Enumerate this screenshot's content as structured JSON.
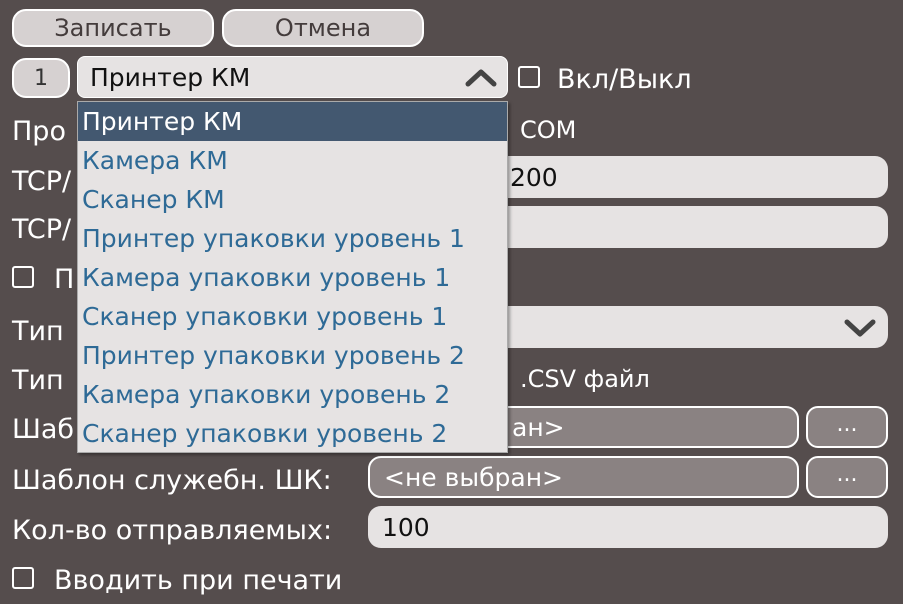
{
  "toolbar": {
    "save_label": "Записать",
    "cancel_label": "Отмена"
  },
  "device": {
    "index": "1",
    "selected_type": "Принтер КМ",
    "enabled_label": "Вкл/Выкл"
  },
  "dropdown": {
    "options": [
      "Принтер КМ",
      "Камера КМ",
      "Сканер КМ",
      "Принтер упаковки уровень 1",
      "Камера упаковки уровень 1",
      "Сканер упаковки уровень 1",
      "Принтер упаковки уровень 2",
      "Камера упаковки уровень 2",
      "Сканер упаковки уровень 2"
    ]
  },
  "form": {
    "protocol_label_partial": "Про",
    "protocol_value_partial": "COM",
    "tcp1_label_partial": "TCP/",
    "tcp1_value_partial": "200",
    "tcp2_label_partial": "TCP/",
    "tcp2_value_partial": "",
    "check_partial": "П",
    "type1_label_partial": "Тип",
    "type2_label_partial": "Тип",
    "type2_value_partial": ".CSV файл",
    "template1_label_partial": "Шаб",
    "template1_value_partial": "ан>",
    "browse_label": "...",
    "service_template_label": "Шаблон служебн. ШК:",
    "service_template_value": "<не выбран>",
    "send_count_label": "Кол-во отправляемых:",
    "send_count_value": "100",
    "enter_on_print_label": "Вводить при печати"
  }
}
